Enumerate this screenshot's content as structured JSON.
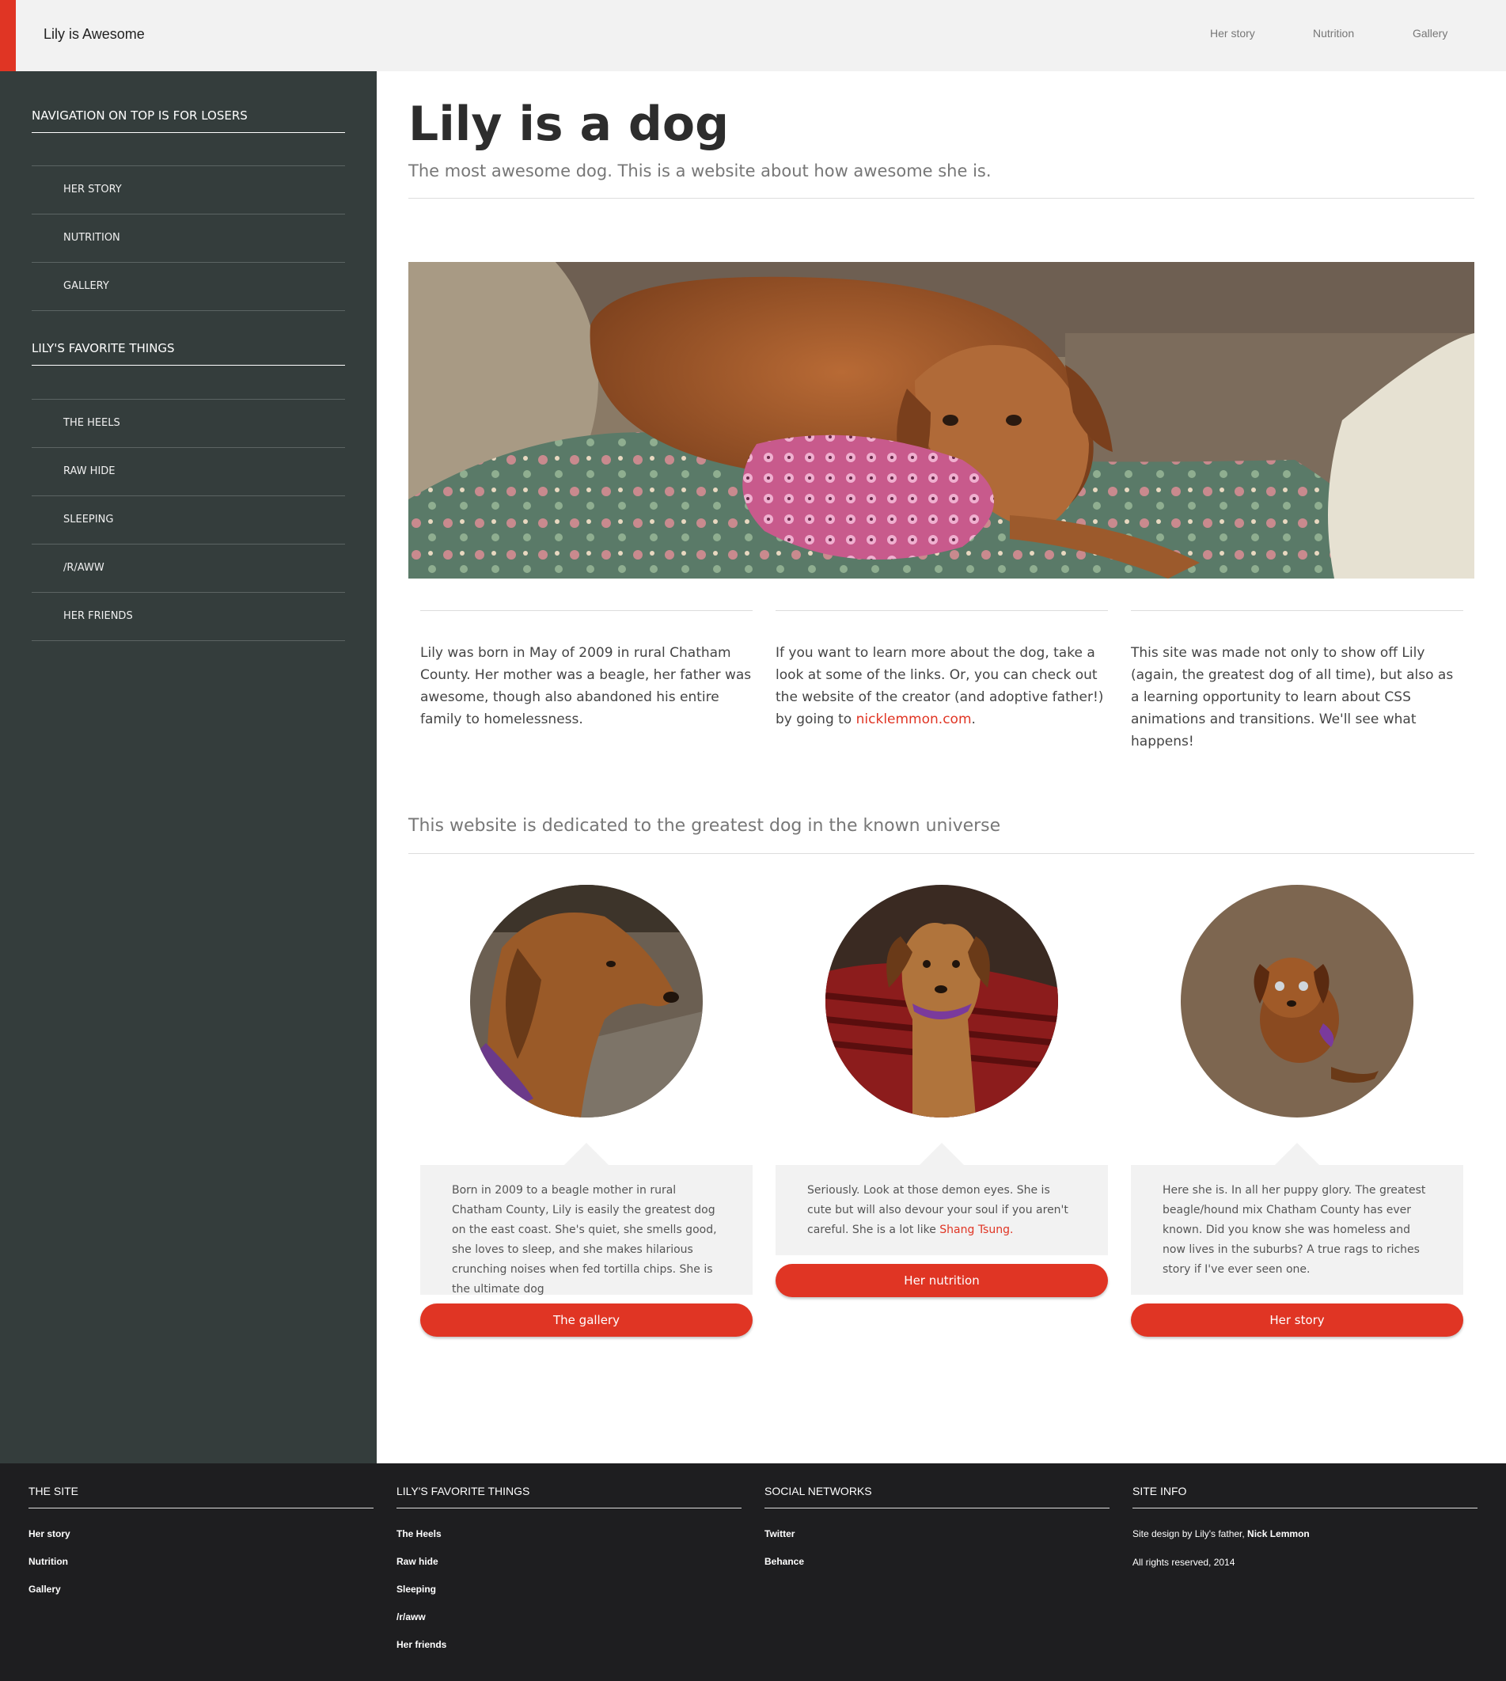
{
  "header": {
    "brand": "Lily is Awesome",
    "nav": [
      "Her story",
      "Nutrition",
      "Gallery"
    ]
  },
  "sidebar": {
    "section1": {
      "heading": "Navigation on top is for losers",
      "items": [
        "Her story",
        "Nutrition",
        "Gallery"
      ]
    },
    "section2": {
      "heading": "Lily's favorite things",
      "items": [
        "The Heels",
        "Raw hide",
        "Sleeping",
        "/r/aww",
        "Her friends"
      ]
    }
  },
  "main": {
    "title": "Lily is a dog",
    "subtitle": "The most awesome dog. This is a website about how awesome she is.",
    "intro": [
      {
        "text": "Lily was born in May of 2009 in rural Chatham County. Her mother was a beagle, her father was awesome, though also abandoned his entire family to homelessness."
      },
      {
        "text": "If you want to learn more about the dog, take a look at some of the links. Or, you can check out the website of the creator (and adoptive father!) by going to ",
        "link": "nicklemmon.com",
        "after": "."
      },
      {
        "text": "This site was made not only to show off Lily (again, the greatest dog of all time), but also as a learning opportunity to learn about CSS animations and transitions. We'll see what happens!"
      }
    ],
    "dedicated": "This website is dedicated to the greatest dog in the known universe",
    "cards": [
      {
        "text": "Born in 2009 to a beagle mother in rural Chatham County, Lily is easily the greatest dog on the east coast. She's quiet, she smells good, she loves to sleep, and she makes hilarious crunching noises when fed tortilla chips. She is the ultimate dog",
        "button": "The gallery"
      },
      {
        "text": "Seriously. Look at those demon eyes. She is cute but will also devour your soul if you aren't careful. She is a lot like ",
        "link": "Shang Tsung.",
        "button": "Her nutrition"
      },
      {
        "text": "Here she is. In all her puppy glory. The greatest beagle/hound mix Chatham County has ever known. Did you know she was homeless and now lives in the suburbs? A true rags to riches story if I've ever seen one.",
        "button": "Her story"
      }
    ]
  },
  "footer": {
    "site": {
      "heading": "The site",
      "links": [
        "Her story",
        "Nutrition",
        "Gallery"
      ]
    },
    "favorites": {
      "heading": "Lily's favorite things",
      "links": [
        "The Heels",
        "Raw hide",
        "Sleeping",
        "/r/aww",
        "Her friends"
      ]
    },
    "social": {
      "heading": "Social networks",
      "links": [
        "Twitter",
        "Behance"
      ]
    },
    "info": {
      "heading": "Site info",
      "design_prefix": "Site design by Lily's father, ",
      "designer": "Nick Lemmon",
      "rights": "All rights reserved, 2014"
    }
  },
  "colors": {
    "accent": "#e03524",
    "sidebar": "#343d3c",
    "footer": "#1e1e20",
    "header": "#f2f2f2"
  }
}
